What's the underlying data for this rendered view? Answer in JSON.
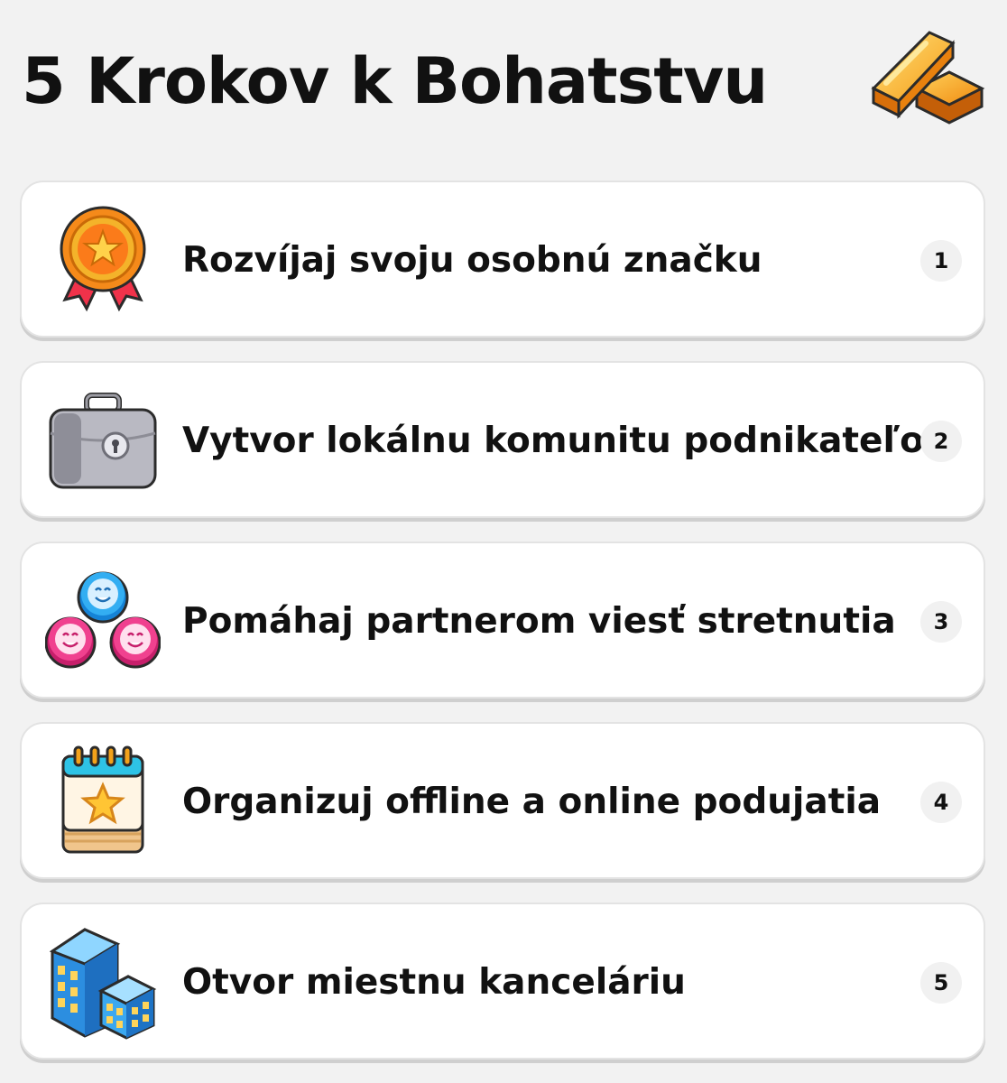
{
  "header": {
    "title": "5 Krokov k Bohatstvu",
    "icon": "gold-bars-icon"
  },
  "steps": [
    {
      "label": "Rozvíjaj svoju osobnú značku",
      "number": "1",
      "icon": "award-medal-icon"
    },
    {
      "label": "Vytvor lokálnu komunitu podnikateľov",
      "number": "2",
      "icon": "briefcase-lock-icon"
    },
    {
      "label": "Pomáhaj partnerom viesť stretnutia",
      "number": "3",
      "icon": "people-group-icon"
    },
    {
      "label": "Organizuj offline a online podujatia",
      "number": "4",
      "icon": "calendar-star-icon"
    },
    {
      "label": "Otvor miestnu kanceláriu",
      "number": "5",
      "icon": "office-buildings-icon"
    }
  ],
  "colors": {
    "background": "#f2f2f2",
    "card": "#ffffff",
    "gold": "#f7a21b",
    "blue": "#2ba4f0",
    "pink": "#f0418f"
  }
}
